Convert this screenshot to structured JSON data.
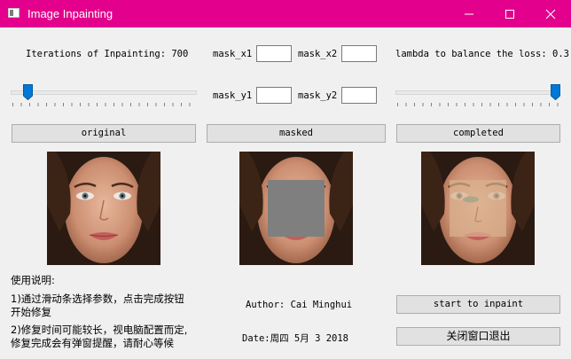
{
  "window": {
    "title": "Image Inpainting"
  },
  "controls": {
    "iterations_label": "Iterations of Inpainting: 700",
    "iterations_value": 0.07,
    "lambda_label": "lambda to balance the loss: 0.3",
    "lambda_value": 1.0,
    "mask_x1_label": "mask_x1",
    "mask_x2_label": "mask_x2",
    "mask_y1_label": "mask_y1",
    "mask_y2_label": "mask_y2",
    "mask_x1_value": "",
    "mask_x2_value": "",
    "mask_y1_value": "",
    "mask_y2_value": ""
  },
  "buttons": {
    "original": "original",
    "masked": "masked",
    "completed": "completed",
    "start": "start to inpaint",
    "quit": "关闭窗口退出"
  },
  "instructions": {
    "heading": "使用说明:",
    "line1a": "1)通过滑动条选择参数，点击完成按钮",
    "line1b": "开始修复",
    "line2a": "2)修复时间可能较长，视电脑配置而定,",
    "line2b": "修复完成会有弹窗提醒，请耐心等候"
  },
  "info": {
    "author": "Author: Cai Minghui",
    "date": "Date:周四 5月 3 2018"
  },
  "colors": {
    "titlebar": "#e3008c",
    "slider_thumb": "#0078d7",
    "mask_fill": "#7f7f7f"
  }
}
